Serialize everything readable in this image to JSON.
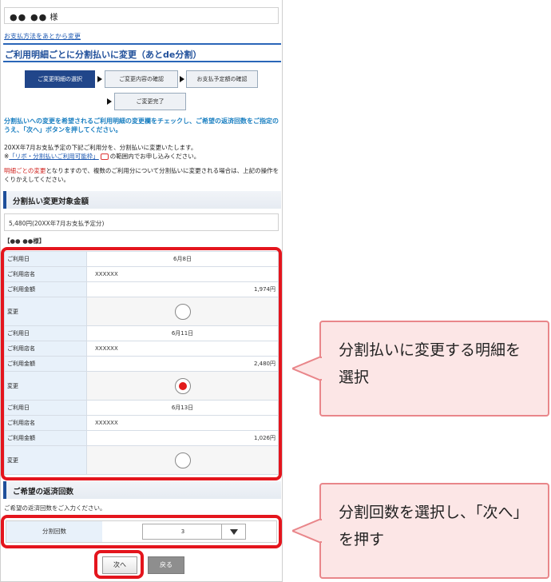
{
  "header": {
    "user_name": "●● ●●",
    "user_suffix": "様",
    "breadcrumb_link": "お支払方法をあとから変更"
  },
  "page_title": "ご利用明細ごとに分割払いに変更（あとde分割）",
  "steps": [
    {
      "label": "ご変更明細の選択"
    },
    {
      "label": "ご変更内容の確認"
    },
    {
      "label": "お支払予定額の確認"
    },
    {
      "label": "ご変更完了"
    }
  ],
  "instructions": {
    "blue": "分割払いへの変更を希望されるご利用明細の変更欄をチェックし、ご希望の返済回数をご指定のうえ、「次へ」ボタンを押してください。",
    "line1": "20XX年7月お支払予定の下記ご利用分を、分割払いに変更いたします。",
    "line2_prefix": "※",
    "line2_link": "「リボ・分割払いご利用可能枠」",
    "line2_suffix": "の範囲内でお申し込みください。",
    "note_red": "明細ごとの変更",
    "note_rest": "となりますので、複数のご利用分について分割払いに変更される場合は、上記の操作をくりかえしてください。"
  },
  "section_amount": {
    "title": "分割払い変更対象金額",
    "amount": "5,480円(20XX年7月お支払予定分)",
    "member": "【●● ●●様】"
  },
  "details": {
    "labels": {
      "date": "ご利用日",
      "store": "ご利用店名",
      "amount": "ご利用金額",
      "change": "変更"
    },
    "rows": [
      {
        "date": "6月8日",
        "store": "XXXXXX",
        "amount": "1,974円",
        "checked": false
      },
      {
        "date": "6月11日",
        "store": "XXXXXX",
        "amount": "2,480円",
        "checked": true
      },
      {
        "date": "6月13日",
        "store": "XXXXXX",
        "amount": "1,026円",
        "checked": false
      }
    ]
  },
  "section_repay": {
    "title": "ご希望の返済回数",
    "hint": "ご希望の返済回数をご入力ください。",
    "label": "分割回数",
    "selected": "3"
  },
  "buttons": {
    "next": "次へ",
    "back": "戻る"
  },
  "callouts": {
    "select_detail": "分割払いに変更する明細を選択",
    "select_count": "分割回数を選択し、「次へ」を押す"
  },
  "colors": {
    "accent_red": "#e4151d",
    "callout_bg": "#fce6e6",
    "nav_blue": "#21468a"
  }
}
